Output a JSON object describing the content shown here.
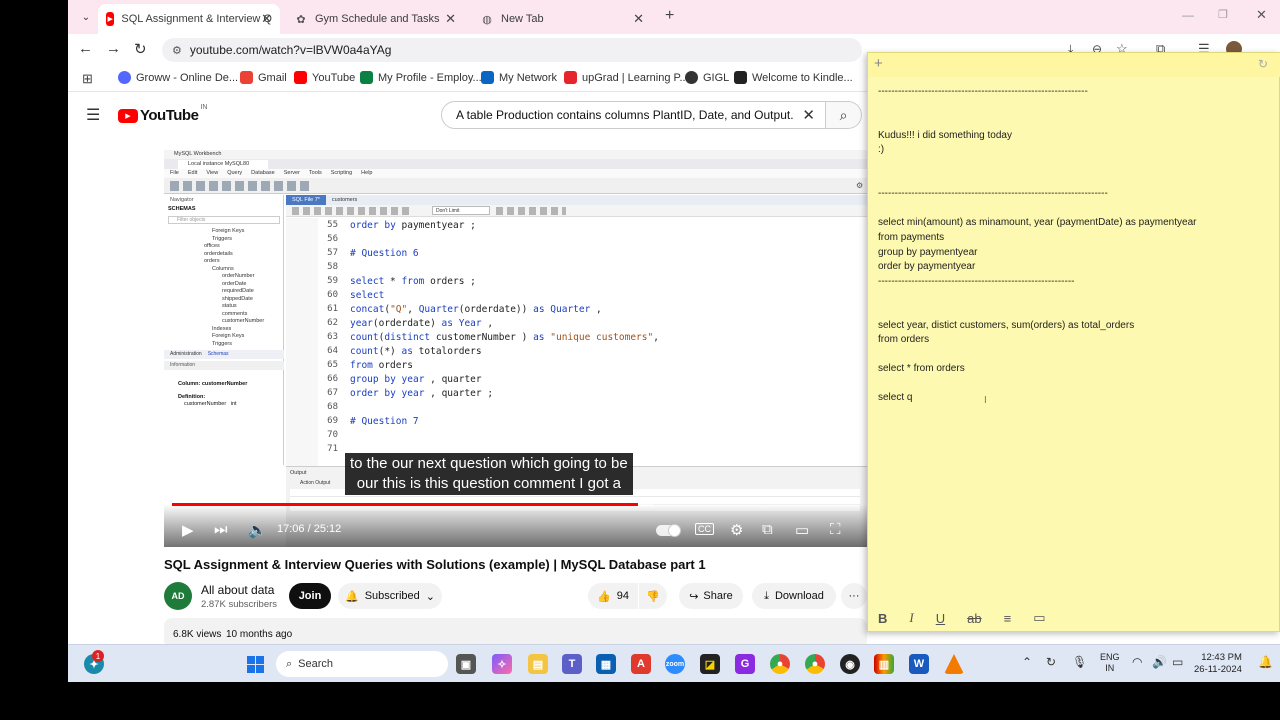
{
  "browser": {
    "tabs": [
      {
        "label": "SQL Assignment & Interview Q",
        "active": true
      },
      {
        "label": "Gym Schedule and Tasks",
        "active": false
      },
      {
        "label": "New Tab",
        "active": false
      }
    ],
    "new_tab_symbol": "+",
    "url": "youtube.com/watch?v=lBVW0a4aYAg",
    "bookmarks": [
      {
        "label": "Groww - Online De...",
        "color": "#5367ff"
      },
      {
        "label": "Gmail",
        "color": "#ea4335"
      },
      {
        "label": "YouTube",
        "color": "#ff0000"
      },
      {
        "label": "My Profile - Employ...",
        "color": "#0b8043"
      },
      {
        "label": "My Network",
        "color": "#0a66c2"
      },
      {
        "label": "upGrad | Learning P...",
        "color": "#e5242b"
      },
      {
        "label": "GIGL",
        "color": "#333333"
      },
      {
        "label": "Welcome to Kindle...",
        "color": "#222222"
      }
    ]
  },
  "youtube": {
    "logo_text": "YouTube",
    "logo_region": "IN",
    "search_query": "A table Production contains columns PlantID, Date, and Output. Write",
    "video": {
      "workbench_title": "MySQL Workbench",
      "instance_tab": "Local instance MySQL80",
      "menu": [
        "File",
        "Edit",
        "View",
        "Query",
        "Database",
        "Server",
        "Tools",
        "Scripting",
        "Help"
      ],
      "navigator_label": "Navigator",
      "schemas_label": "SCHEMAS",
      "filter_placeholder": "Filter objects",
      "tree": [
        "Foreign Keys",
        "Triggers",
        "offices",
        "orderdetails",
        "orders",
        "Columns",
        "orderNumber",
        "orderDate",
        "requiredDate",
        "shippedDate",
        "status",
        "comments",
        "customerNumber",
        "Indexes",
        "Foreign Keys",
        "Triggers"
      ],
      "admin_tabs": [
        "Administration",
        "Schemas"
      ],
      "information_label": "Information",
      "column_info": "Column: customerNumber",
      "definition_label": "Definition:",
      "definition_value": "customerNumber   int",
      "editor_tabs": [
        "SQL File 7*",
        "customers"
      ],
      "limit_label": "Don't Limit",
      "code_lines": [
        {
          "n": "55",
          "text": "order by paymentyear ;"
        },
        {
          "n": "56",
          "text": ""
        },
        {
          "n": "57",
          "text": "# Question 6"
        },
        {
          "n": "58",
          "text": ""
        },
        {
          "n": "59",
          "text": "select * from orders ;"
        },
        {
          "n": "60",
          "text": "select"
        },
        {
          "n": "61",
          "text": "concat(\"Q\", Quarter(orderdate)) as Quarter ,"
        },
        {
          "n": "62",
          "text": "year(orderdate) as Year ,"
        },
        {
          "n": "63",
          "text": "count(distinct customerNumber ) as \"unique customers\","
        },
        {
          "n": "64",
          "text": "count(*) as totalorders"
        },
        {
          "n": "65",
          "text": "from orders"
        },
        {
          "n": "66",
          "text": "group by year , quarter"
        },
        {
          "n": "67",
          "text": "order by year , quarter ;"
        },
        {
          "n": "68",
          "text": ""
        },
        {
          "n": "69",
          "text": "# Question 7"
        },
        {
          "n": "70",
          "text": ""
        },
        {
          "n": "71",
          "text": ""
        }
      ],
      "output_label": "Output",
      "action_output_label": "Action Output",
      "caption_line1": "to the our next question which going to be",
      "caption_line2": "our this is this question comment I got a",
      "time_current": "17:06",
      "time_total": "25:12",
      "progress_fraction": 0.679,
      "buffered_fraction": 0.7
    },
    "title": "SQL Assignment & Interview Queries with Solutions (example) | MySQL Database part 1",
    "channel_name": "All about data",
    "subscribers": "2.87K subscribers",
    "join_label": "Join",
    "subscribed_label": "Subscribed",
    "likes": "94",
    "share_label": "Share",
    "download_label": "Download",
    "more_label": "···",
    "views": "6.8K views",
    "age": "10 months ago"
  },
  "sticky_note": {
    "content": "---------------------------------------------------------------\n\n\nKudus!!! i did something today\n:)\n\n\n---------------------------------------------------------------------\n\nselect min(amount) as minamount, year (paymentDate) as paymentyear\nfrom payments\ngroup by paymentyear\norder by paymentyear\n-----------------------------------------------------------\n\n\nselect year, distict customers, sum(orders) as total_orders\nfrom orders\n\nselect * from orders\n\nselect q",
    "format_buttons": [
      "B",
      "I",
      "U",
      "ab",
      "≡",
      "▭"
    ]
  },
  "taskbar": {
    "search_label": "Search",
    "lang_line1": "ENG",
    "lang_line2": "IN",
    "time": "12:43 PM",
    "date": "26-11-2024",
    "notification_count": "1"
  }
}
